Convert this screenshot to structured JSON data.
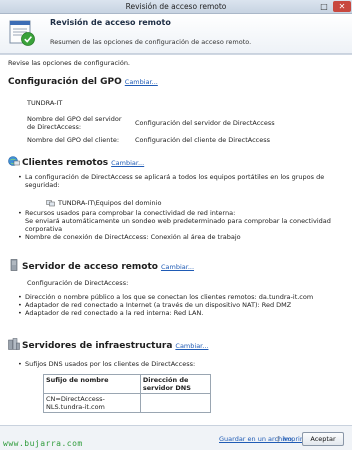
{
  "window": {
    "title": "Revisión de acceso remoto",
    "maximize_glyph": "□",
    "close_glyph": "✕"
  },
  "header": {
    "title": "Revisión de acceso remoto",
    "subtitle": "Resumen de las opciones de configuración de acceso remoto.",
    "icon": "checklist-icon"
  },
  "intro": "Revise las opciones de configuración.",
  "gpo": {
    "title": "Configuración del GPO",
    "change": "Cambiar...",
    "domain": "TUNDRA-IT",
    "server_label": "Nombre del GPO del servidor de DirectAccess:",
    "server_value": "Configuración del servidor de DirectAccess",
    "client_label": "Nombre del GPO del cliente:",
    "client_value": "Configuración del cliente de DirectAccess"
  },
  "clients": {
    "title": "Clientes remotos",
    "change": "Cambiar...",
    "item1": "La configuración de DirectAccess se aplicará a todos los equipos portátiles en los grupos de seguridad:",
    "group": "TUNDRA-IT\\Equipos del dominio",
    "item2a": "Recursos usados para comprobar la conectividad de red interna:",
    "item2b": "Se enviará automáticamente un sondeo web predeterminado para comprobar la conectividad corporativa",
    "item3": "Nombre de conexión de DirectAccess: Conexión al área de trabajo"
  },
  "server": {
    "title": "Servidor de acceso remoto",
    "change": "Cambiar...",
    "intro": "Configuración de DirectAccess:",
    "items": [
      "Dirección o nombre público a los que se conectan los clientes remotos: da.tundra-it.com",
      "Adaptador de red conectado a Internet (a través de un dispositivo NAT): Red DMZ",
      "Adaptador de red conectado a la red interna: Red LAN."
    ]
  },
  "infra": {
    "title": "Servidores de infraestructura",
    "change": "Cambiar...",
    "item": "Sufijos DNS usados por los clientes de DirectAccess:",
    "table": {
      "headers": [
        "Sufijo de nombre",
        "Dirección de servidor DNS"
      ],
      "rows": [
        [
          "CN=DirectAccess-NLS.tundra-it.com",
          ""
        ]
      ]
    }
  },
  "footer": {
    "brand": "www.bujarra.com",
    "save": "Guardar en un archivo",
    "print": "Imprimir",
    "accept": "Aceptar",
    "separator": "|"
  }
}
